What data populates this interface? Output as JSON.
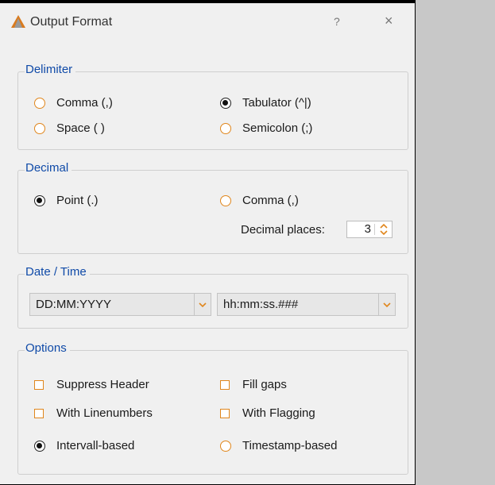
{
  "window": {
    "title": "Output Format",
    "help_label": "?",
    "close_label": "×"
  },
  "colors": {
    "accent_orange": "#e0861c",
    "legend_blue": "#0f4aa8",
    "background": "#f0f0f0"
  },
  "delimiter": {
    "legend": "Delimiter",
    "options": [
      {
        "label": "Comma (,)",
        "selected": false
      },
      {
        "label": "Tabulator (^|)",
        "selected": true
      },
      {
        "label": "Space ( )",
        "selected": false
      },
      {
        "label": "Semicolon (;)",
        "selected": false
      }
    ]
  },
  "decimal": {
    "legend": "Decimal",
    "options": [
      {
        "label": "Point (.)",
        "selected": true
      },
      {
        "label": "Comma (,)",
        "selected": false
      }
    ],
    "places_label": "Decimal places:",
    "places_value": "3"
  },
  "datetime": {
    "legend": "Date / Time",
    "date_format": "DD:MM:YYYY",
    "time_format": "hh:mm:ss.###"
  },
  "options": {
    "legend": "Options",
    "checkboxes": [
      {
        "label": "Suppress Header",
        "checked": false
      },
      {
        "label": "Fill gaps",
        "checked": false
      },
      {
        "label": "With Linenumbers",
        "checked": false
      },
      {
        "label": "With Flagging",
        "checked": false
      }
    ],
    "radios": [
      {
        "label": "Intervall-based",
        "selected": true
      },
      {
        "label": "Timestamp-based",
        "selected": false
      }
    ]
  }
}
